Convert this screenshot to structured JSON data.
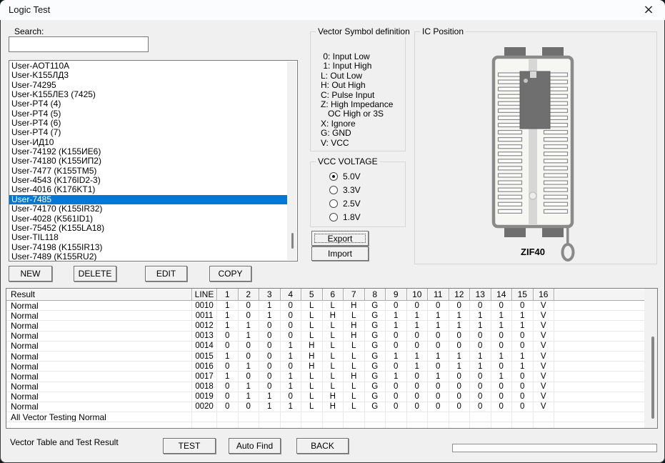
{
  "window": {
    "title": "Logic Test",
    "close_glyph": "×"
  },
  "search": {
    "label": "Search:",
    "value": ""
  },
  "chip_list": {
    "selected_index": 14,
    "items": [
      "User-AOT110A",
      "User-K155ЛД3",
      "User-74295",
      "User-K155ЛЕ3 (7425)",
      "User-PT4 (4)",
      "User-PT4 (5)",
      "User-PT4 (6)",
      "User-PT4 (7)",
      "User-ИД10",
      "User-74192 (K155ИЕ6)",
      "User-74180 (K155ИП2)",
      "User-7477 (K155TM5)",
      "User-4543 (K176ID2-3)",
      "User-4016 (K176KT1)",
      "User-7485",
      "User-74170 (K155IR32)",
      "User-4028 (K561ID1)",
      "User-75452 (K155LA18)",
      "User-TIL118",
      "User-74198 (K155IR13)",
      "User-7489 (K155RU2)"
    ]
  },
  "list_buttons": {
    "new": "NEW",
    "delete": "DELETE",
    "edit": "EDIT",
    "copy": "COPY"
  },
  "vector_symbols": {
    "title": "Vector Symbol definition",
    "lines": [
      " 0: Input Low",
      " 1: Input High",
      "L: Out Low",
      "H: Out High",
      "C: Pulse Input",
      "Z: High Impedance",
      "   OC High or 3S",
      "X: Ignore",
      "G: GND",
      "V: VCC"
    ]
  },
  "vcc_voltage": {
    "title": "VCC VOLTAGE",
    "options": [
      {
        "label": "5.0V",
        "selected": true
      },
      {
        "label": "3.3V",
        "selected": false
      },
      {
        "label": "2.5V",
        "selected": false
      },
      {
        "label": "1.8V",
        "selected": false
      }
    ]
  },
  "io_buttons": {
    "export": "Export",
    "import": "Import"
  },
  "ic_position": {
    "title": "IC Position",
    "socket_label": "ZIF40"
  },
  "result_table": {
    "columns": [
      "Result",
      "LINE",
      "1",
      "2",
      "3",
      "4",
      "5",
      "6",
      "7",
      "8",
      "9",
      "10",
      "11",
      "12",
      "13",
      "14",
      "15",
      "16"
    ],
    "rows": [
      {
        "result": "Normal",
        "line": "0010",
        "values": [
          "1",
          "0",
          "1",
          "0",
          "L",
          "L",
          "H",
          "G",
          "0",
          "0",
          "0",
          "0",
          "0",
          "0",
          "0",
          "V"
        ]
      },
      {
        "result": "Normal",
        "line": "0011",
        "values": [
          "1",
          "0",
          "1",
          "0",
          "L",
          "H",
          "L",
          "G",
          "1",
          "1",
          "1",
          "1",
          "1",
          "1",
          "1",
          "V"
        ]
      },
      {
        "result": "Normal",
        "line": "0012",
        "values": [
          "1",
          "1",
          "0",
          "0",
          "L",
          "L",
          "H",
          "G",
          "1",
          "1",
          "1",
          "1",
          "1",
          "1",
          "1",
          "V"
        ]
      },
      {
        "result": "Normal",
        "line": "0013",
        "values": [
          "0",
          "1",
          "0",
          "0",
          "L",
          "L",
          "H",
          "G",
          "0",
          "0",
          "0",
          "0",
          "0",
          "0",
          "0",
          "V"
        ]
      },
      {
        "result": "Normal",
        "line": "0014",
        "values": [
          "0",
          "0",
          "0",
          "1",
          "H",
          "L",
          "L",
          "G",
          "0",
          "0",
          "0",
          "0",
          "0",
          "0",
          "0",
          "V"
        ]
      },
      {
        "result": "Normal",
        "line": "0015",
        "values": [
          "1",
          "0",
          "0",
          "1",
          "H",
          "L",
          "L",
          "G",
          "1",
          "1",
          "1",
          "1",
          "1",
          "1",
          "1",
          "V"
        ]
      },
      {
        "result": "Normal",
        "line": "0016",
        "values": [
          "0",
          "1",
          "0",
          "0",
          "H",
          "L",
          "L",
          "G",
          "0",
          "1",
          "0",
          "1",
          "1",
          "0",
          "1",
          "V"
        ]
      },
      {
        "result": "Normal",
        "line": "0017",
        "values": [
          "1",
          "0",
          "0",
          "1",
          "L",
          "L",
          "H",
          "G",
          "1",
          "0",
          "1",
          "0",
          "0",
          "1",
          "0",
          "V"
        ]
      },
      {
        "result": "Normal",
        "line": "0018",
        "values": [
          "0",
          "1",
          "0",
          "1",
          "L",
          "L",
          "L",
          "G",
          "0",
          "0",
          "0",
          "0",
          "0",
          "0",
          "0",
          "V"
        ]
      },
      {
        "result": "Normal",
        "line": "0019",
        "values": [
          "0",
          "1",
          "1",
          "0",
          "L",
          "H",
          "L",
          "G",
          "0",
          "0",
          "0",
          "0",
          "0",
          "0",
          "0",
          "V"
        ]
      },
      {
        "result": "Normal",
        "line": "0020",
        "values": [
          "0",
          "0",
          "1",
          "1",
          "L",
          "H",
          "L",
          "G",
          "0",
          "0",
          "0",
          "0",
          "0",
          "0",
          "0",
          "V"
        ]
      }
    ],
    "footer_row": "All Vector Testing Normal"
  },
  "bottom_bar": {
    "status_label": "Vector Table and Test Result",
    "test": "TEST",
    "auto_find": "Auto Find",
    "back": "BACK",
    "progress_percent": 0
  },
  "colors": {
    "selection_bg": "#0078d7",
    "selection_text": "#ffffff",
    "window_bg": "#f0f0f0",
    "titlebar_bg": "#fafcfe",
    "socket_outline": "#8a8a8a",
    "chip_body": "#6f6f6f"
  }
}
